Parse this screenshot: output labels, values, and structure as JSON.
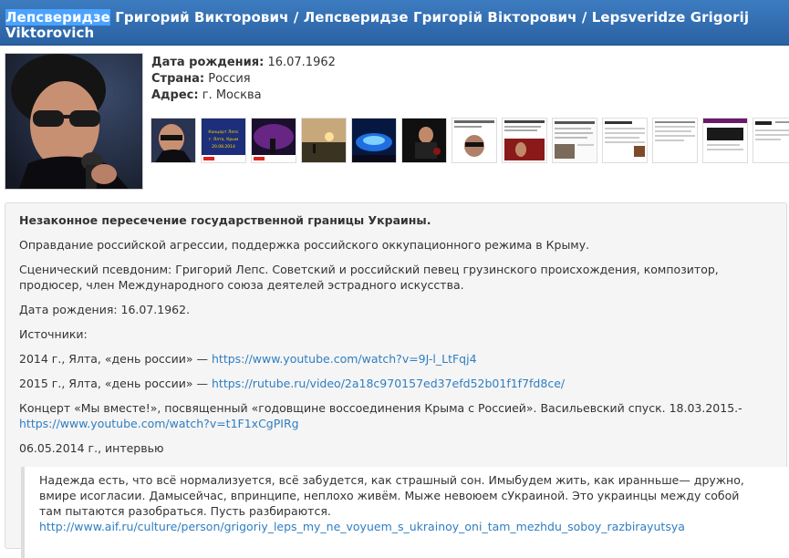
{
  "header": {
    "title_highlight": "Лепсверидзе",
    "title_rest": " Григорий Викторович / Лепсверидзе Григорій Вікторович / Lepsveridze Grigorij",
    "title_line2": "Viktorovich"
  },
  "info": {
    "birth_label": "Дата рождения:",
    "birth_value": "16.07.1962",
    "country_label": "Страна:",
    "country_value": "Россия",
    "address_label": "Адрес:",
    "address_value": "г. Москва"
  },
  "thumbnails": [
    {
      "theme": "portrait"
    },
    {
      "theme": "poster",
      "text": "Концерт Григорий Лепс г. Ялта, Крым 20 августа 2014 г."
    },
    {
      "theme": "stage-purple"
    },
    {
      "theme": "outdoor-dusk"
    },
    {
      "theme": "stage-blue"
    },
    {
      "theme": "tv-studio"
    },
    {
      "theme": "news-article"
    },
    {
      "theme": "web-page"
    },
    {
      "theme": "web-page"
    },
    {
      "theme": "web-page"
    },
    {
      "theme": "web-page"
    },
    {
      "theme": "web-page"
    },
    {
      "theme": "web-page"
    }
  ],
  "content": {
    "heading": "Незаконное пересечение государственной границы Украины.",
    "p1": "Оправдание российской агрессии, поддержка российского оккупационного режима в Крыму.",
    "p2_line1": "Сценический псевдоним: Григорий Лепс. Советский и российский певец грузинского происхождения, композитор,",
    "p2_line2": "продюсер, член Международного союза деятелей эстрадного искусства.",
    "p3": "Дата рождения: 16.07.1962.",
    "p4": "Источники:",
    "src1_text": "2014 г., Ялта, «день россии» — ",
    "src1_link": "https://www.youtube.com/watch?v=9J-l_LtFqj4",
    "src2_text": "2015 г., Ялта, «день россии» — ",
    "src2_link": "https://rutube.ru/video/2a18c970157ed37efd52b01f1f7fd8ce/",
    "src3_text": "Концерт «Мы вместе!», посвященный «годовщине воссоединения Крыма с Россией». Васильевский спуск. 18.03.2015.-",
    "src3_link": "https://www.youtube.com/watch?v=t1F1xCgPIRg",
    "p5": "06.05.2014 г., интервью",
    "quote_line1": "Надежда есть, что всё нормализуется, всё забудется, как страшный сон. Имыбудем жить, как иранньше— дружно,",
    "quote_line2": "вмире исогласии. Дамысейчас, впринципе, неплохо живём. Мыже невоюем сУкраиной. Это украинцы между собой",
    "quote_line3": "там пытаются разобраться. Пусть разбираются.",
    "quote_link": "http://www.aif.ru/culture/person/grigoriy_leps_my_ne_voyuem_s_ukrainoy_oni_tam_mezhdu_soboy_razbirayutsya"
  }
}
